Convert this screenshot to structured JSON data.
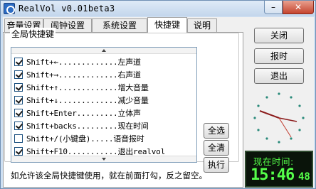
{
  "window": {
    "title": "RealVol v0.01beta3",
    "minimize_glyph": "–",
    "close_glyph": "✕"
  },
  "tabs": [
    {
      "label": "音量设置"
    },
    {
      "label": "闹钟设置"
    },
    {
      "label": "系统设置"
    },
    {
      "label": "快捷键"
    },
    {
      "label": "说明"
    }
  ],
  "hotkeys": {
    "group_label": "全局快捷键",
    "items": [
      {
        "text": "Shift+←.............左声道",
        "checked": true
      },
      {
        "text": "Shift+→.............右声道",
        "checked": true
      },
      {
        "text": "Shift+↑.............增大音量",
        "checked": true
      },
      {
        "text": "Shift+↓.............减少音量",
        "checked": true
      },
      {
        "text": "Shift+Enter.........立体声",
        "checked": true
      },
      {
        "text": "Shift+backs.........现在时间",
        "checked": true
      },
      {
        "text": "Shift+/(小键盘).....语音报时",
        "checked": false
      },
      {
        "text": "Shift+F10...........退出realvol",
        "checked": true
      }
    ],
    "select_all": "全选",
    "clear_all": "全清",
    "execute": "执行",
    "hint": "如允许该全局快捷键使用，就在前面打勾，反之留空。"
  },
  "side_buttons": {
    "close": "关闭",
    "announce_time": "报时",
    "quit": "退出"
  },
  "lcd": {
    "label": "现在时间:",
    "time": "15:46",
    "seconds": "48"
  },
  "colors": {
    "accent": "#2c6cc4",
    "lcd_green": "#55ff4a",
    "lcd_bg": "#0a140a",
    "clock_hand": "#8b1a1a"
  }
}
